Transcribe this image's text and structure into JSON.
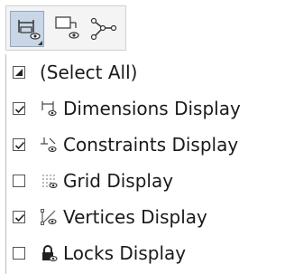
{
  "toolbar": {
    "buttons": [
      {
        "icon": "dimensions-visibility-icon",
        "active": true
      },
      {
        "icon": "constraints-visibility-icon",
        "active": false
      },
      {
        "icon": "vertices-icon",
        "active": false
      }
    ]
  },
  "menu": {
    "items": [
      {
        "label": "(Select All)",
        "state": "indeterminate",
        "icon": ""
      },
      {
        "label": "Dimensions Display",
        "state": "checked",
        "icon": "dimension-icon"
      },
      {
        "label": "Constraints Display",
        "state": "checked",
        "icon": "constraint-icon"
      },
      {
        "label": "Grid Display",
        "state": "unchecked",
        "icon": "grid-icon"
      },
      {
        "label": "Vertices Display",
        "state": "checked",
        "icon": "vertex-icon"
      },
      {
        "label": "Locks Display",
        "state": "unchecked",
        "icon": "lock-icon"
      }
    ]
  }
}
